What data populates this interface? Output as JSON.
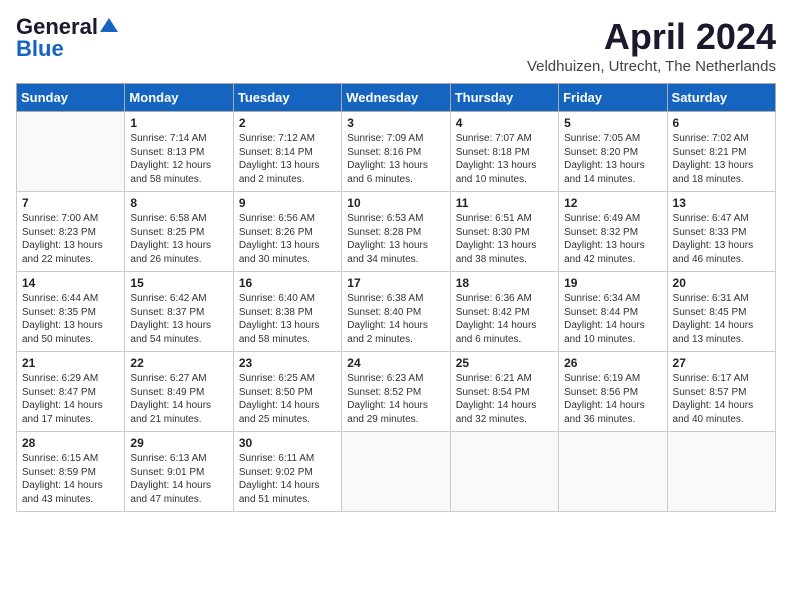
{
  "header": {
    "logo_general": "General",
    "logo_blue": "Blue",
    "month_year": "April 2024",
    "location": "Veldhuizen, Utrecht, The Netherlands"
  },
  "weekdays": [
    "Sunday",
    "Monday",
    "Tuesday",
    "Wednesday",
    "Thursday",
    "Friday",
    "Saturday"
  ],
  "weeks": [
    [
      {
        "day": "",
        "info": ""
      },
      {
        "day": "1",
        "info": "Sunrise: 7:14 AM\nSunset: 8:13 PM\nDaylight: 12 hours\nand 58 minutes."
      },
      {
        "day": "2",
        "info": "Sunrise: 7:12 AM\nSunset: 8:14 PM\nDaylight: 13 hours\nand 2 minutes."
      },
      {
        "day": "3",
        "info": "Sunrise: 7:09 AM\nSunset: 8:16 PM\nDaylight: 13 hours\nand 6 minutes."
      },
      {
        "day": "4",
        "info": "Sunrise: 7:07 AM\nSunset: 8:18 PM\nDaylight: 13 hours\nand 10 minutes."
      },
      {
        "day": "5",
        "info": "Sunrise: 7:05 AM\nSunset: 8:20 PM\nDaylight: 13 hours\nand 14 minutes."
      },
      {
        "day": "6",
        "info": "Sunrise: 7:02 AM\nSunset: 8:21 PM\nDaylight: 13 hours\nand 18 minutes."
      }
    ],
    [
      {
        "day": "7",
        "info": "Sunrise: 7:00 AM\nSunset: 8:23 PM\nDaylight: 13 hours\nand 22 minutes."
      },
      {
        "day": "8",
        "info": "Sunrise: 6:58 AM\nSunset: 8:25 PM\nDaylight: 13 hours\nand 26 minutes."
      },
      {
        "day": "9",
        "info": "Sunrise: 6:56 AM\nSunset: 8:26 PM\nDaylight: 13 hours\nand 30 minutes."
      },
      {
        "day": "10",
        "info": "Sunrise: 6:53 AM\nSunset: 8:28 PM\nDaylight: 13 hours\nand 34 minutes."
      },
      {
        "day": "11",
        "info": "Sunrise: 6:51 AM\nSunset: 8:30 PM\nDaylight: 13 hours\nand 38 minutes."
      },
      {
        "day": "12",
        "info": "Sunrise: 6:49 AM\nSunset: 8:32 PM\nDaylight: 13 hours\nand 42 minutes."
      },
      {
        "day": "13",
        "info": "Sunrise: 6:47 AM\nSunset: 8:33 PM\nDaylight: 13 hours\nand 46 minutes."
      }
    ],
    [
      {
        "day": "14",
        "info": "Sunrise: 6:44 AM\nSunset: 8:35 PM\nDaylight: 13 hours\nand 50 minutes."
      },
      {
        "day": "15",
        "info": "Sunrise: 6:42 AM\nSunset: 8:37 PM\nDaylight: 13 hours\nand 54 minutes."
      },
      {
        "day": "16",
        "info": "Sunrise: 6:40 AM\nSunset: 8:38 PM\nDaylight: 13 hours\nand 58 minutes."
      },
      {
        "day": "17",
        "info": "Sunrise: 6:38 AM\nSunset: 8:40 PM\nDaylight: 14 hours\nand 2 minutes."
      },
      {
        "day": "18",
        "info": "Sunrise: 6:36 AM\nSunset: 8:42 PM\nDaylight: 14 hours\nand 6 minutes."
      },
      {
        "day": "19",
        "info": "Sunrise: 6:34 AM\nSunset: 8:44 PM\nDaylight: 14 hours\nand 10 minutes."
      },
      {
        "day": "20",
        "info": "Sunrise: 6:31 AM\nSunset: 8:45 PM\nDaylight: 14 hours\nand 13 minutes."
      }
    ],
    [
      {
        "day": "21",
        "info": "Sunrise: 6:29 AM\nSunset: 8:47 PM\nDaylight: 14 hours\nand 17 minutes."
      },
      {
        "day": "22",
        "info": "Sunrise: 6:27 AM\nSunset: 8:49 PM\nDaylight: 14 hours\nand 21 minutes."
      },
      {
        "day": "23",
        "info": "Sunrise: 6:25 AM\nSunset: 8:50 PM\nDaylight: 14 hours\nand 25 minutes."
      },
      {
        "day": "24",
        "info": "Sunrise: 6:23 AM\nSunset: 8:52 PM\nDaylight: 14 hours\nand 29 minutes."
      },
      {
        "day": "25",
        "info": "Sunrise: 6:21 AM\nSunset: 8:54 PM\nDaylight: 14 hours\nand 32 minutes."
      },
      {
        "day": "26",
        "info": "Sunrise: 6:19 AM\nSunset: 8:56 PM\nDaylight: 14 hours\nand 36 minutes."
      },
      {
        "day": "27",
        "info": "Sunrise: 6:17 AM\nSunset: 8:57 PM\nDaylight: 14 hours\nand 40 minutes."
      }
    ],
    [
      {
        "day": "28",
        "info": "Sunrise: 6:15 AM\nSunset: 8:59 PM\nDaylight: 14 hours\nand 43 minutes."
      },
      {
        "day": "29",
        "info": "Sunrise: 6:13 AM\nSunset: 9:01 PM\nDaylight: 14 hours\nand 47 minutes."
      },
      {
        "day": "30",
        "info": "Sunrise: 6:11 AM\nSunset: 9:02 PM\nDaylight: 14 hours\nand 51 minutes."
      },
      {
        "day": "",
        "info": ""
      },
      {
        "day": "",
        "info": ""
      },
      {
        "day": "",
        "info": ""
      },
      {
        "day": "",
        "info": ""
      }
    ]
  ]
}
